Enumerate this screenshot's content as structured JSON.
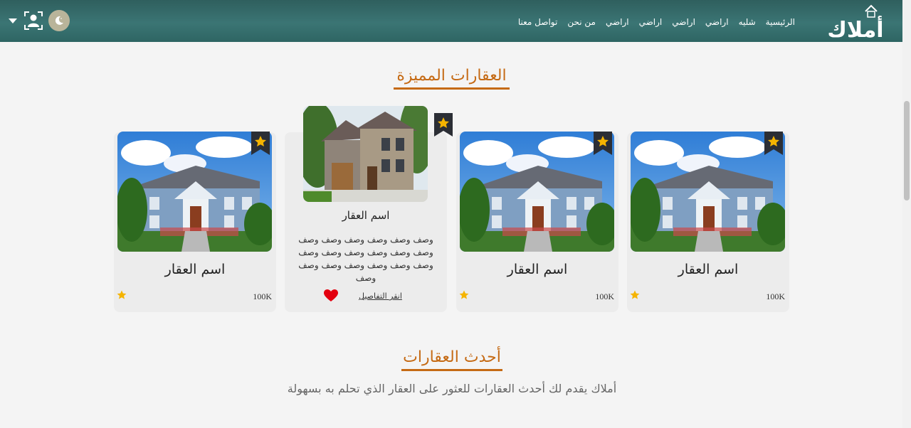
{
  "header": {
    "logo_text": "أملاك",
    "nav": [
      "الرئيسية",
      "شليه",
      "اراضي",
      "اراضي",
      "اراضي",
      "اراضي",
      "من نحن",
      "تواصل معنا"
    ]
  },
  "featured_section": {
    "title": "العقارات المميزة",
    "cards": [
      {
        "name": "اسم العقار",
        "price": "100K"
      },
      {
        "name": "اسم العقار",
        "price": "100K"
      },
      {
        "name": "اسم العقار",
        "description": "وصف وصف وصف وصف وصف وصف وصف وصف وصف وصف وصف وصف وصف وصف وصف وصف وصف وصف وصف",
        "details_link": "انقر التفاصيل"
      },
      {
        "name": "اسم العقار",
        "price": "100K"
      }
    ]
  },
  "latest_section": {
    "title": "أحدث العقارات",
    "subtitle": "أملاك يقدم لك أحدث العقارات للعثور على العقار الذي تحلم به بسهولة"
  },
  "colors": {
    "header": "#3b7574",
    "accent": "#c56a14",
    "star": "#f5b400",
    "heart": "#e3000f"
  },
  "icons": [
    "moon-icon",
    "user-frame-icon",
    "chevron-down-icon",
    "star-icon",
    "heart-icon",
    "bookmark-ribbon-icon"
  ]
}
